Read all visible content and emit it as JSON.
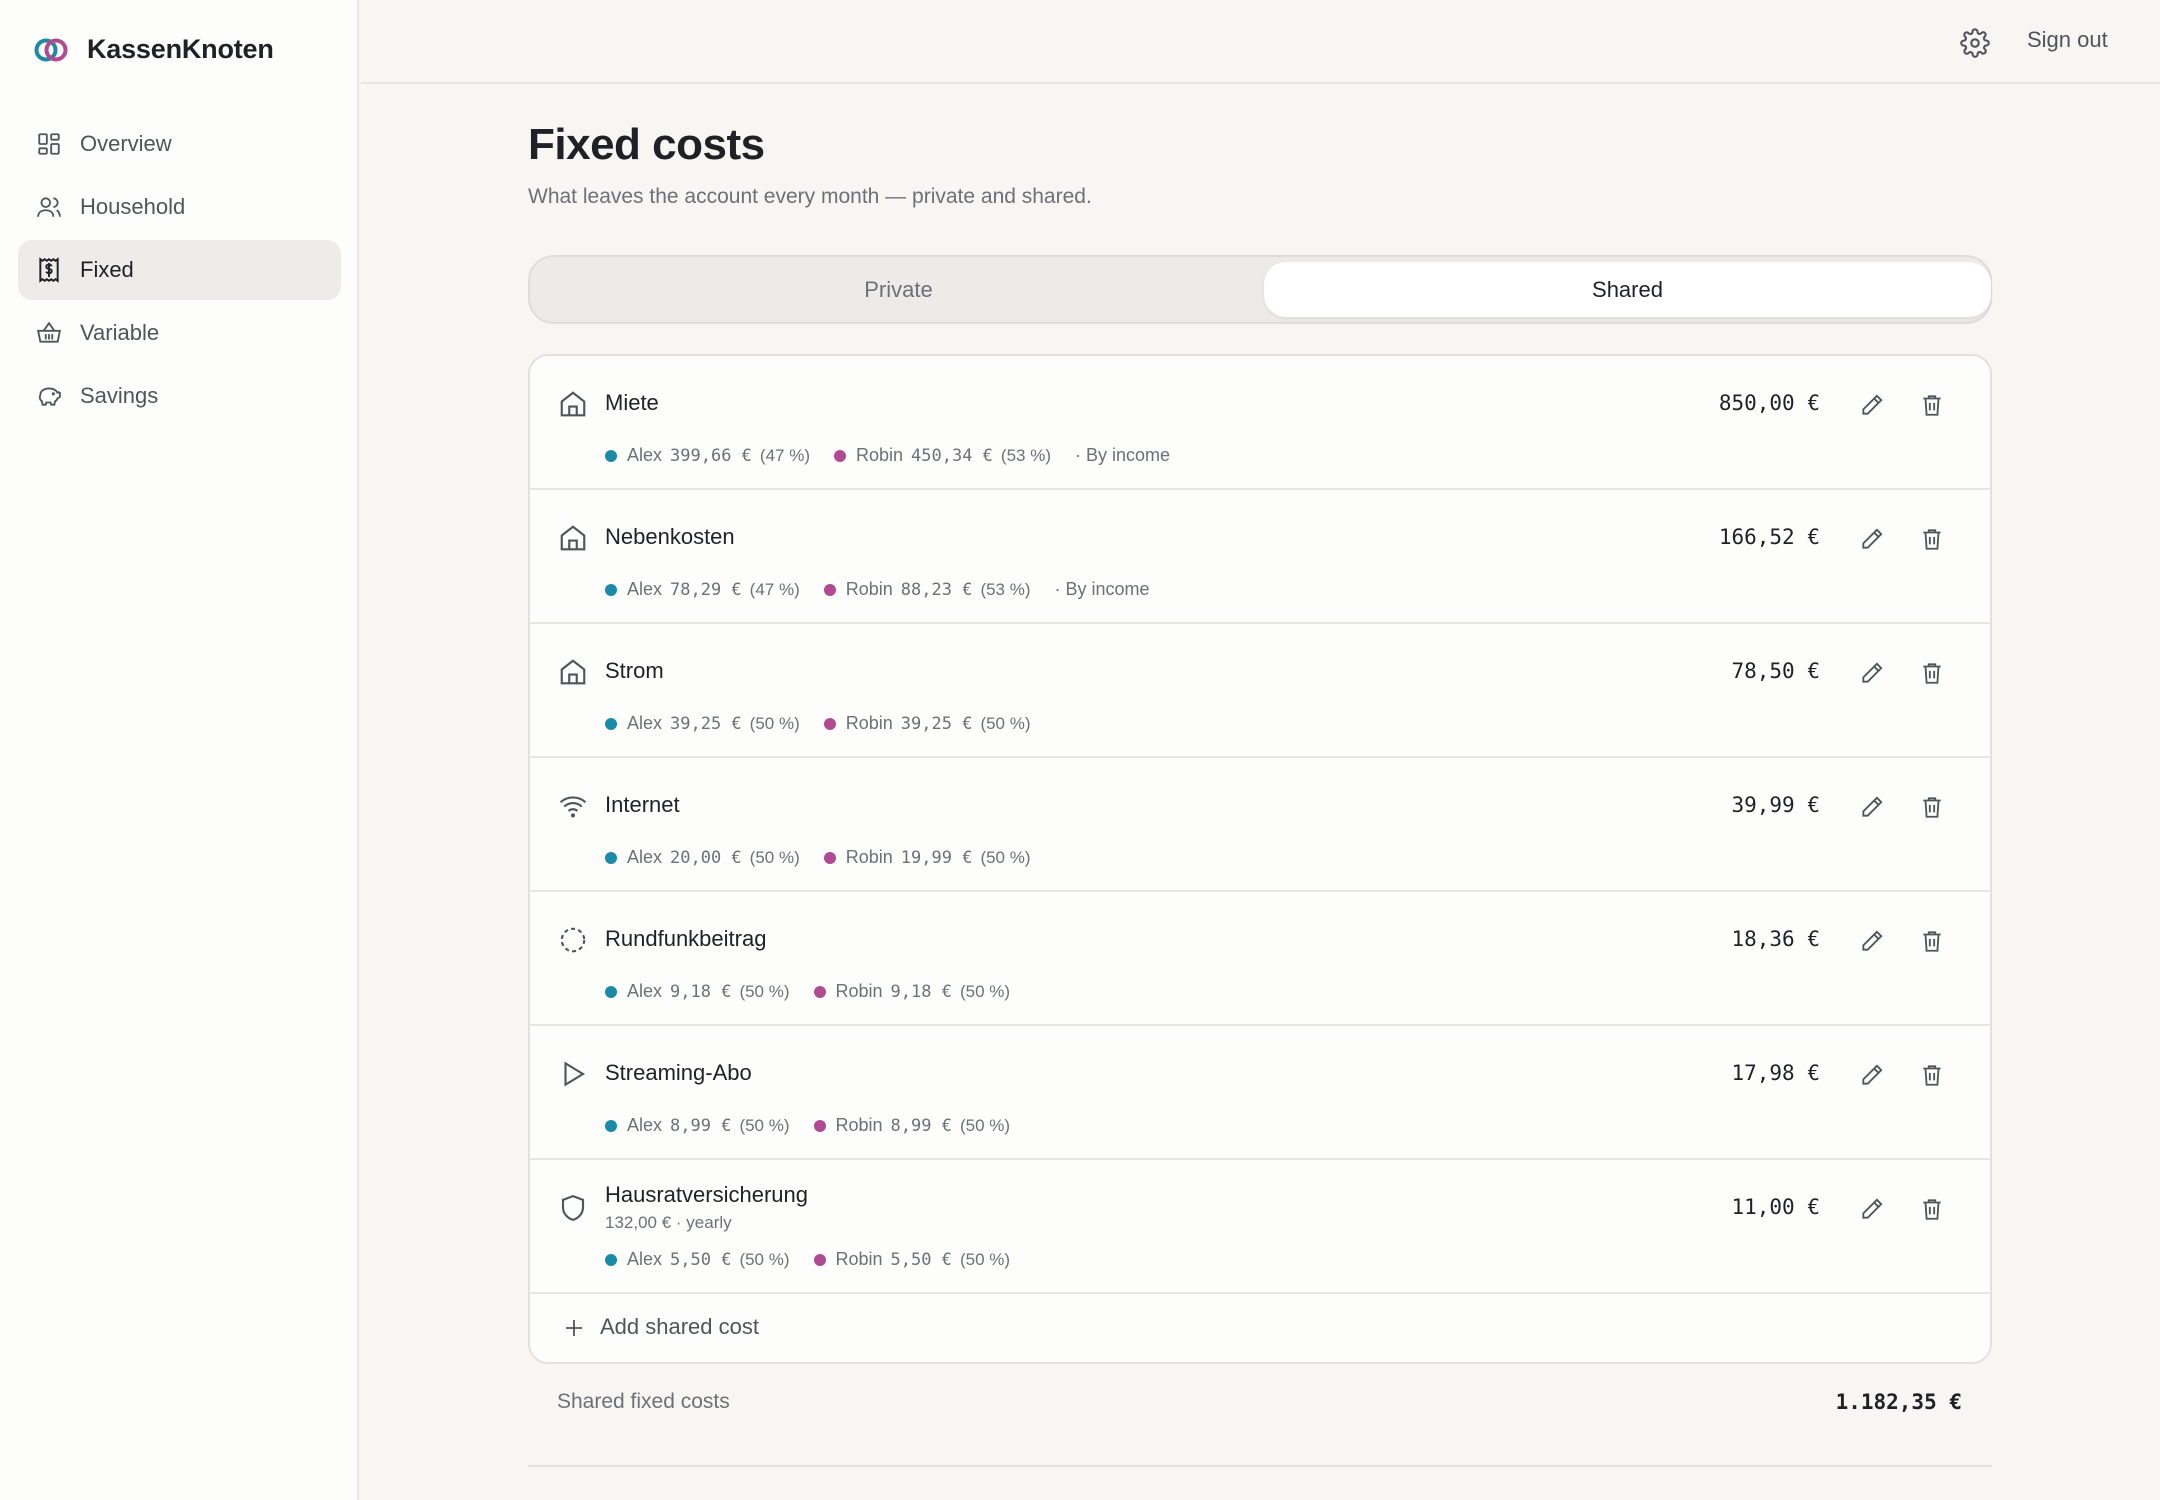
{
  "app": {
    "name": "KassenKnoten"
  },
  "sidebar": {
    "items": [
      {
        "label": "Overview",
        "icon": "grid-icon"
      },
      {
        "label": "Household",
        "icon": "users-icon"
      },
      {
        "label": "Fixed",
        "icon": "receipt-icon",
        "active": true
      },
      {
        "label": "Variable",
        "icon": "basket-icon"
      },
      {
        "label": "Savings",
        "icon": "piggy-bank-icon"
      }
    ]
  },
  "header": {
    "sign_out": "Sign out",
    "settings_icon": "gear-icon"
  },
  "page": {
    "title": "Fixed costs",
    "subtitle": "What leaves the account every month — private and shared."
  },
  "tabs": {
    "private": "Private",
    "shared": "Shared",
    "active": "Shared"
  },
  "costs": [
    {
      "name": "Miete",
      "icon": "home-icon",
      "amount": "850,00 €",
      "alex": {
        "name": "Alex",
        "amount": "399,66 €",
        "pct": "(47 %)"
      },
      "robin": {
        "name": "Robin",
        "amount": "450,34 €",
        "pct": "(53 %)"
      },
      "method": "· By income"
    },
    {
      "name": "Nebenkosten",
      "icon": "home-icon",
      "amount": "166,52 €",
      "alex": {
        "name": "Alex",
        "amount": "78,29 €",
        "pct": "(47 %)"
      },
      "robin": {
        "name": "Robin",
        "amount": "88,23 €",
        "pct": "(53 %)"
      },
      "method": "· By income"
    },
    {
      "name": "Strom",
      "icon": "home-icon",
      "amount": "78,50 €",
      "alex": {
        "name": "Alex",
        "amount": "39,25 €",
        "pct": "(50 %)"
      },
      "robin": {
        "name": "Robin",
        "amount": "39,25 €",
        "pct": "(50 %)"
      }
    },
    {
      "name": "Internet",
      "icon": "wifi-icon",
      "amount": "39,99 €",
      "alex": {
        "name": "Alex",
        "amount": "20,00 €",
        "pct": "(50 %)"
      },
      "robin": {
        "name": "Robin",
        "amount": "19,99 €",
        "pct": "(50 %)"
      }
    },
    {
      "name": "Rundfunkbeitrag",
      "icon": "dashed-circle-icon",
      "amount": "18,36 €",
      "alex": {
        "name": "Alex",
        "amount": "9,18 €",
        "pct": "(50 %)"
      },
      "robin": {
        "name": "Robin",
        "amount": "9,18 €",
        "pct": "(50 %)"
      }
    },
    {
      "name": "Streaming-Abo",
      "icon": "play-icon",
      "amount": "17,98 €",
      "alex": {
        "name": "Alex",
        "amount": "8,99 €",
        "pct": "(50 %)"
      },
      "robin": {
        "name": "Robin",
        "amount": "8,99 €",
        "pct": "(50 %)"
      }
    },
    {
      "name": "Hausratversicherung",
      "icon": "shield-icon",
      "amount": "11,00 €",
      "sub": "132,00 € · yearly",
      "alex": {
        "name": "Alex",
        "amount": "5,50 €",
        "pct": "(50 %)"
      },
      "robin": {
        "name": "Robin",
        "amount": "5,50 €",
        "pct": "(50 %)"
      }
    }
  ],
  "add_label": "Add shared cost",
  "total": {
    "label": "Shared fixed costs",
    "value": "1.182,35 €"
  },
  "colors": {
    "alex": "#1b8aa6",
    "robin": "#b04a92",
    "accent": "#1f2126"
  }
}
